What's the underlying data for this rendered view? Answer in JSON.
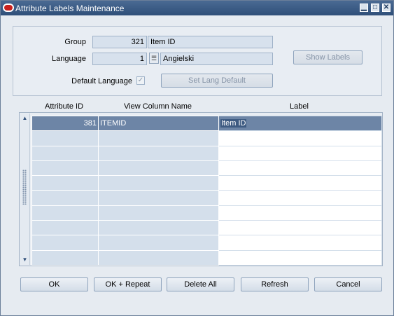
{
  "window": {
    "title": "Attribute Labels Maintenance",
    "controls": {
      "minimize": "▁",
      "maximize": "□",
      "close": "✕"
    }
  },
  "form": {
    "group_label": "Group",
    "group_id": "321",
    "group_name": "Item ID",
    "language_label": "Language",
    "language_id": "1",
    "language_name": "Angielski",
    "default_language_label": "Default Language",
    "default_language_checked": "✓",
    "show_labels_button": "Show Labels",
    "set_lang_default_button": "Set Lang Default"
  },
  "grid": {
    "columns": [
      "Attribute ID",
      "View Column Name",
      "Label"
    ],
    "rows": [
      {
        "attribute_id": "381",
        "view_column_name": "ITEMID",
        "label": "Item ID"
      },
      {
        "attribute_id": "",
        "view_column_name": "",
        "label": ""
      },
      {
        "attribute_id": "",
        "view_column_name": "",
        "label": ""
      },
      {
        "attribute_id": "",
        "view_column_name": "",
        "label": ""
      },
      {
        "attribute_id": "",
        "view_column_name": "",
        "label": ""
      },
      {
        "attribute_id": "",
        "view_column_name": "",
        "label": ""
      },
      {
        "attribute_id": "",
        "view_column_name": "",
        "label": ""
      },
      {
        "attribute_id": "",
        "view_column_name": "",
        "label": ""
      },
      {
        "attribute_id": "",
        "view_column_name": "",
        "label": ""
      },
      {
        "attribute_id": "",
        "view_column_name": "",
        "label": ""
      }
    ],
    "scroll_up": "▲",
    "scroll_down": "▼"
  },
  "buttons": {
    "ok": "OK",
    "ok_repeat": "OK + Repeat",
    "delete_all": "Delete All",
    "refresh": "Refresh",
    "cancel": "Cancel"
  },
  "icons": {
    "title": "oracle-logo-icon",
    "lov": "list-of-values-icon"
  }
}
